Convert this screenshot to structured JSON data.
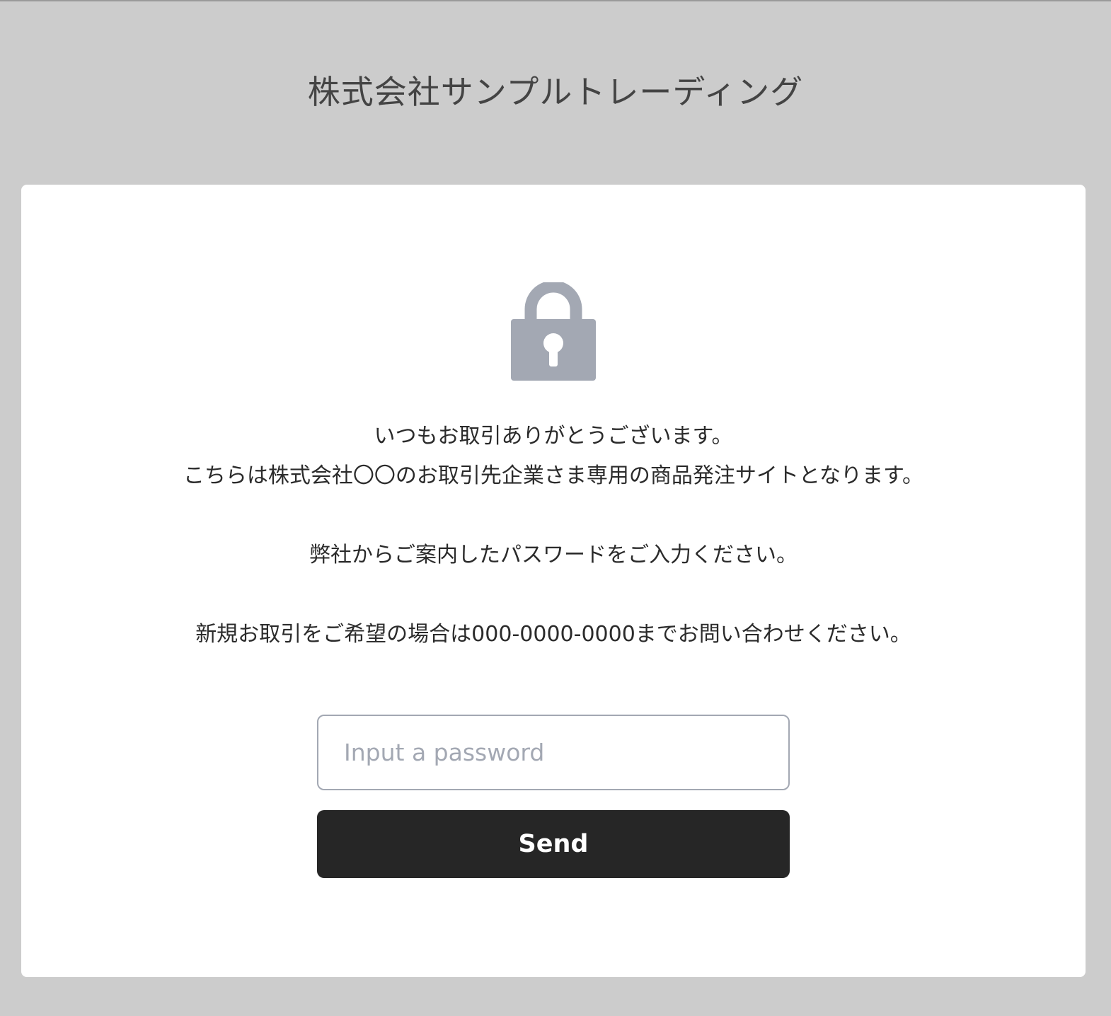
{
  "header": {
    "title": "株式会社サンプルトレーディング"
  },
  "main": {
    "lock_icon": "lock-icon",
    "messages": [
      "いつもお取引ありがとうございます。",
      "こちらは株式会社〇〇のお取引先企業さま専用の商品発注サイトとなります。",
      "弊社からご案内したパスワードをご入力ください。",
      "新規お取引をご希望の場合は000-0000-0000までお問い合わせください。"
    ],
    "password": {
      "value": "",
      "placeholder": "Input a password"
    },
    "send_label": "Send"
  },
  "colors": {
    "background": "#cccccc",
    "card": "#ffffff",
    "icon": "#a3a8b3",
    "button": "#262626",
    "button_text": "#ffffff"
  }
}
